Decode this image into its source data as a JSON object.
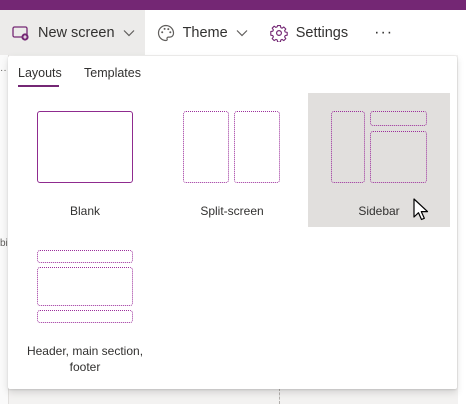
{
  "toolbar": {
    "new_screen_label": "New screen",
    "theme_label": "Theme",
    "settings_label": "Settings",
    "more_label": "···"
  },
  "background": {
    "left_dots": "··",
    "left_fragment": "bi"
  },
  "popover": {
    "tabs": [
      {
        "label": "Layouts",
        "selected": true
      },
      {
        "label": "Templates",
        "selected": false
      }
    ],
    "layouts": [
      {
        "label": "Blank",
        "selected": false
      },
      {
        "label": "Split-screen",
        "selected": false
      },
      {
        "label": "Sidebar",
        "selected": true
      },
      {
        "label_line1": "Header, main section,",
        "label_line2": "footer",
        "selected": false
      }
    ]
  },
  "colors": {
    "accent": "#742774",
    "selected_tile": "#e1dfdd"
  },
  "icons": {
    "new_screen": "new-screen-icon",
    "new_screen_chevron": "chevron-down-icon",
    "theme": "palette-icon",
    "theme_chevron": "chevron-down-icon",
    "settings": "gear-icon",
    "more": "more-icon",
    "cursor": "mouse-pointer-icon"
  }
}
